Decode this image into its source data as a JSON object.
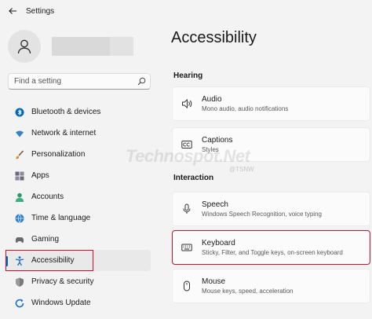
{
  "window": {
    "title": "Settings"
  },
  "search": {
    "placeholder": "Find a setting"
  },
  "sidebar": {
    "items": [
      {
        "label": "Bluetooth & devices",
        "icon": "bluetooth-icon",
        "color": "#0067c0"
      },
      {
        "label": "Network & internet",
        "icon": "wifi-icon",
        "color": "#3b82c4"
      },
      {
        "label": "Personalization",
        "icon": "brush-icon",
        "color": "#d98a2b"
      },
      {
        "label": "Apps",
        "icon": "apps-icon",
        "color": "#6a6a7a"
      },
      {
        "label": "Accounts",
        "icon": "accounts-icon",
        "color": "#2b9a6b"
      },
      {
        "label": "Time & language",
        "icon": "globe-icon",
        "color": "#2f7fc1"
      },
      {
        "label": "Gaming",
        "icon": "gamepad-icon",
        "color": "#6a6a6a"
      },
      {
        "label": "Accessibility",
        "icon": "accessibility-icon",
        "color": "#1f6fc2",
        "active": true
      },
      {
        "label": "Privacy & security",
        "icon": "shield-icon",
        "color": "#6a6a6a"
      },
      {
        "label": "Windows Update",
        "icon": "update-icon",
        "color": "#1f6fc2"
      }
    ]
  },
  "main": {
    "title": "Accessibility",
    "sections": [
      {
        "label": "Hearing",
        "items": [
          {
            "title": "Audio",
            "subtitle": "Mono audio, audio notifications",
            "icon": "speaker-icon"
          },
          {
            "title": "Captions",
            "subtitle": "Styles",
            "icon": "captions-icon"
          }
        ]
      },
      {
        "label": "Interaction",
        "items": [
          {
            "title": "Speech",
            "subtitle": "Windows Speech Recognition, voice typing",
            "icon": "microphone-icon"
          },
          {
            "title": "Keyboard",
            "subtitle": "Sticky, Filter, and Toggle keys, on-screen keyboard",
            "icon": "keyboard-icon",
            "highlighted": true
          },
          {
            "title": "Mouse",
            "subtitle": "Mouse keys, speed, acceleration",
            "icon": "mouse-icon"
          }
        ]
      }
    ]
  },
  "watermark": {
    "text": "Technospot.Net",
    "tag": "@TSNW"
  },
  "colors": {
    "accent": "#0067c0",
    "highlight_outline": "#c8102e"
  }
}
